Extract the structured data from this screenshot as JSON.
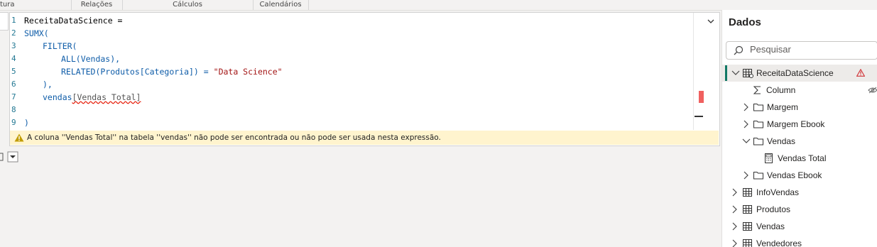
{
  "ribbon": {
    "tabs": [
      "tura",
      "Relações",
      "Cálculos",
      "Calendários"
    ]
  },
  "editor": {
    "lines": [
      {
        "n": "1",
        "text": "ReceitaDataScience ="
      },
      {
        "n": "2",
        "text": "SUMX("
      },
      {
        "n": "3",
        "text": "FILTER("
      },
      {
        "n": "4",
        "text": "ALL(Vendas),"
      },
      {
        "n": "5",
        "text": "RELATED(Produtos[Categoria]) = \"Data Science\""
      },
      {
        "n": "6",
        "text": "),"
      },
      {
        "n": "7",
        "text": "vendas[Vendas Total]"
      },
      {
        "n": "8",
        "text": ""
      },
      {
        "n": "9",
        "text": ")"
      }
    ],
    "error_message": "A coluna ''Vendas Total'' na tabela ''vendas'' não pode ser encontrada ou não pode ser usada nesta expressão."
  },
  "panel": {
    "title": "Dados",
    "search_placeholder": "Pesquisar",
    "items": [
      {
        "label": "ReceitaDataScience",
        "icon": "table-icon",
        "expanded": true,
        "selected": true,
        "warning": true
      },
      {
        "label": "Column",
        "icon": "sigma-icon",
        "hidden": true
      },
      {
        "label": "Margem",
        "icon": "folder-icon"
      },
      {
        "label": "Margem Ebook",
        "icon": "folder-icon"
      },
      {
        "label": "Vendas",
        "icon": "folder-icon",
        "expanded": true
      },
      {
        "label": "Vendas Total",
        "icon": "calculator-icon"
      },
      {
        "label": "Vendas Ebook",
        "icon": "folder-icon"
      },
      {
        "label": "InfoVendas",
        "icon": "table-icon"
      },
      {
        "label": "Produtos",
        "icon": "table-icon"
      },
      {
        "label": "Vendas",
        "icon": "table-icon"
      },
      {
        "label": "Vendedores",
        "icon": "table-icon"
      }
    ]
  },
  "colors": {
    "accent": "#117865",
    "keyword": "#0e5ca8",
    "string": "#a31515",
    "line_number": "#237893",
    "warning_bg": "#fff4ce",
    "error_red": "#e51400"
  }
}
